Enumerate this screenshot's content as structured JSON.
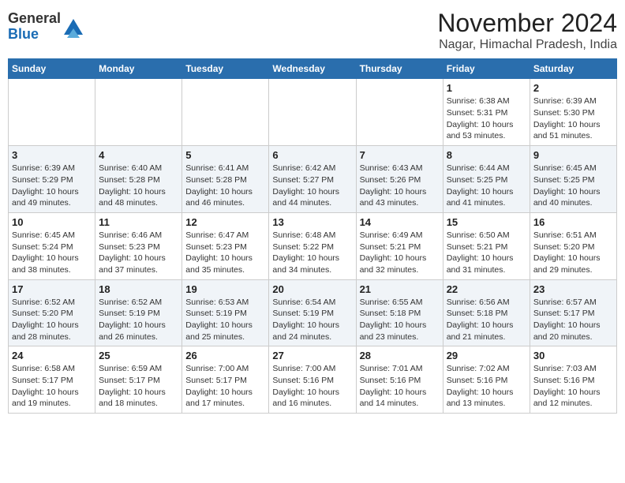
{
  "logo": {
    "line1": "General",
    "line2": "Blue"
  },
  "title": "November 2024",
  "subtitle": "Nagar, Himachal Pradesh, India",
  "days_of_week": [
    "Sunday",
    "Monday",
    "Tuesday",
    "Wednesday",
    "Thursday",
    "Friday",
    "Saturday"
  ],
  "weeks": [
    [
      {
        "day": "",
        "info": ""
      },
      {
        "day": "",
        "info": ""
      },
      {
        "day": "",
        "info": ""
      },
      {
        "day": "",
        "info": ""
      },
      {
        "day": "",
        "info": ""
      },
      {
        "day": "1",
        "info": "Sunrise: 6:38 AM\nSunset: 5:31 PM\nDaylight: 10 hours and 53 minutes."
      },
      {
        "day": "2",
        "info": "Sunrise: 6:39 AM\nSunset: 5:30 PM\nDaylight: 10 hours and 51 minutes."
      }
    ],
    [
      {
        "day": "3",
        "info": "Sunrise: 6:39 AM\nSunset: 5:29 PM\nDaylight: 10 hours and 49 minutes."
      },
      {
        "day": "4",
        "info": "Sunrise: 6:40 AM\nSunset: 5:28 PM\nDaylight: 10 hours and 48 minutes."
      },
      {
        "day": "5",
        "info": "Sunrise: 6:41 AM\nSunset: 5:28 PM\nDaylight: 10 hours and 46 minutes."
      },
      {
        "day": "6",
        "info": "Sunrise: 6:42 AM\nSunset: 5:27 PM\nDaylight: 10 hours and 44 minutes."
      },
      {
        "day": "7",
        "info": "Sunrise: 6:43 AM\nSunset: 5:26 PM\nDaylight: 10 hours and 43 minutes."
      },
      {
        "day": "8",
        "info": "Sunrise: 6:44 AM\nSunset: 5:25 PM\nDaylight: 10 hours and 41 minutes."
      },
      {
        "day": "9",
        "info": "Sunrise: 6:45 AM\nSunset: 5:25 PM\nDaylight: 10 hours and 40 minutes."
      }
    ],
    [
      {
        "day": "10",
        "info": "Sunrise: 6:45 AM\nSunset: 5:24 PM\nDaylight: 10 hours and 38 minutes."
      },
      {
        "day": "11",
        "info": "Sunrise: 6:46 AM\nSunset: 5:23 PM\nDaylight: 10 hours and 37 minutes."
      },
      {
        "day": "12",
        "info": "Sunrise: 6:47 AM\nSunset: 5:23 PM\nDaylight: 10 hours and 35 minutes."
      },
      {
        "day": "13",
        "info": "Sunrise: 6:48 AM\nSunset: 5:22 PM\nDaylight: 10 hours and 34 minutes."
      },
      {
        "day": "14",
        "info": "Sunrise: 6:49 AM\nSunset: 5:21 PM\nDaylight: 10 hours and 32 minutes."
      },
      {
        "day": "15",
        "info": "Sunrise: 6:50 AM\nSunset: 5:21 PM\nDaylight: 10 hours and 31 minutes."
      },
      {
        "day": "16",
        "info": "Sunrise: 6:51 AM\nSunset: 5:20 PM\nDaylight: 10 hours and 29 minutes."
      }
    ],
    [
      {
        "day": "17",
        "info": "Sunrise: 6:52 AM\nSunset: 5:20 PM\nDaylight: 10 hours and 28 minutes."
      },
      {
        "day": "18",
        "info": "Sunrise: 6:52 AM\nSunset: 5:19 PM\nDaylight: 10 hours and 26 minutes."
      },
      {
        "day": "19",
        "info": "Sunrise: 6:53 AM\nSunset: 5:19 PM\nDaylight: 10 hours and 25 minutes."
      },
      {
        "day": "20",
        "info": "Sunrise: 6:54 AM\nSunset: 5:19 PM\nDaylight: 10 hours and 24 minutes."
      },
      {
        "day": "21",
        "info": "Sunrise: 6:55 AM\nSunset: 5:18 PM\nDaylight: 10 hours and 23 minutes."
      },
      {
        "day": "22",
        "info": "Sunrise: 6:56 AM\nSunset: 5:18 PM\nDaylight: 10 hours and 21 minutes."
      },
      {
        "day": "23",
        "info": "Sunrise: 6:57 AM\nSunset: 5:17 PM\nDaylight: 10 hours and 20 minutes."
      }
    ],
    [
      {
        "day": "24",
        "info": "Sunrise: 6:58 AM\nSunset: 5:17 PM\nDaylight: 10 hours and 19 minutes."
      },
      {
        "day": "25",
        "info": "Sunrise: 6:59 AM\nSunset: 5:17 PM\nDaylight: 10 hours and 18 minutes."
      },
      {
        "day": "26",
        "info": "Sunrise: 7:00 AM\nSunset: 5:17 PM\nDaylight: 10 hours and 17 minutes."
      },
      {
        "day": "27",
        "info": "Sunrise: 7:00 AM\nSunset: 5:16 PM\nDaylight: 10 hours and 16 minutes."
      },
      {
        "day": "28",
        "info": "Sunrise: 7:01 AM\nSunset: 5:16 PM\nDaylight: 10 hours and 14 minutes."
      },
      {
        "day": "29",
        "info": "Sunrise: 7:02 AM\nSunset: 5:16 PM\nDaylight: 10 hours and 13 minutes."
      },
      {
        "day": "30",
        "info": "Sunrise: 7:03 AM\nSunset: 5:16 PM\nDaylight: 10 hours and 12 minutes."
      }
    ]
  ]
}
